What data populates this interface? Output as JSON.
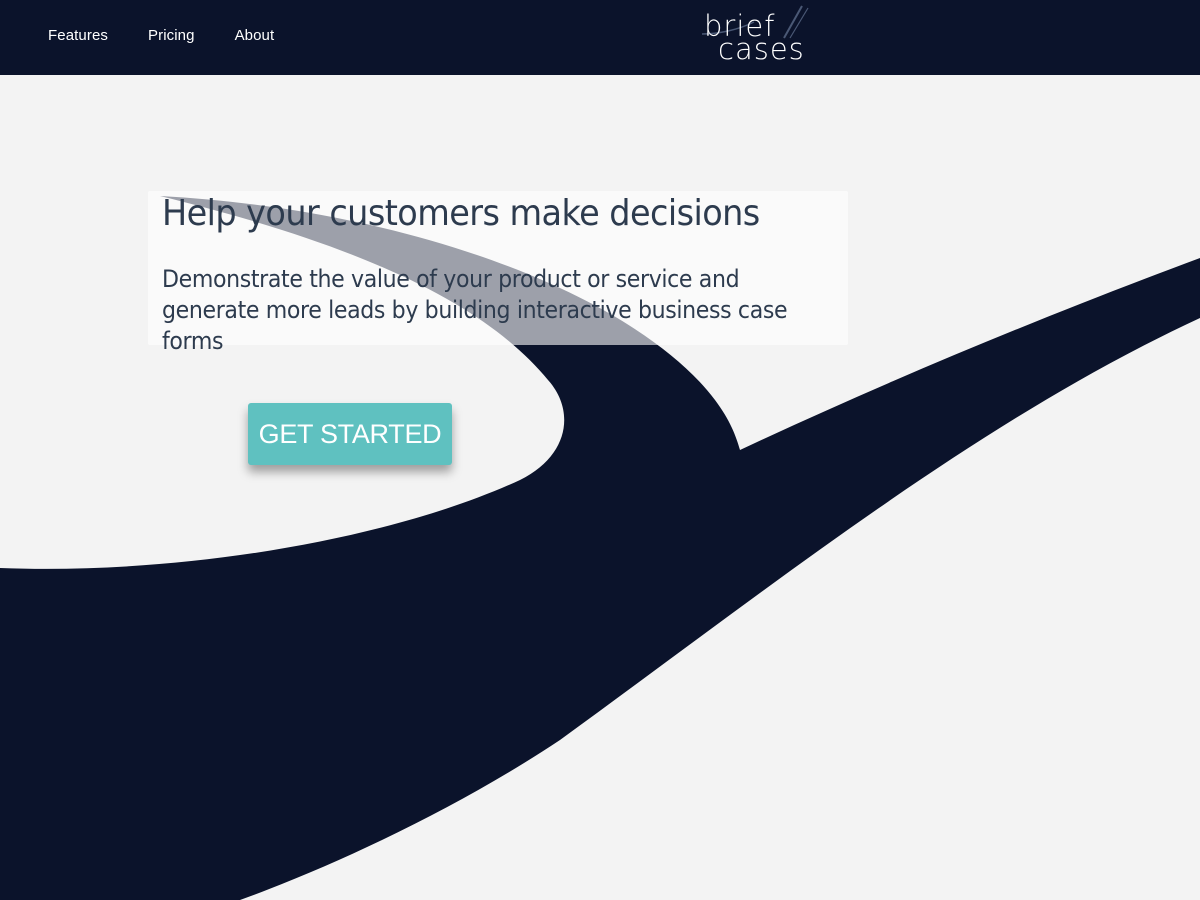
{
  "nav": {
    "links": [
      "Features",
      "Pricing",
      "About"
    ]
  },
  "logo": {
    "line1": "brief",
    "line2": "cases"
  },
  "hero": {
    "title": "Help your customers make decisions",
    "subtitle": "Demonstrate the value of your product or service and generate more leads by building interactive business case forms",
    "cta_label": "GET STARTED"
  },
  "colors": {
    "navbar_bg": "#0b132b",
    "page_bg": "#f3f3f3",
    "swoosh": "#0b132b",
    "accent_button": "#5fc1c0",
    "heading_text": "#2d3b4e"
  }
}
